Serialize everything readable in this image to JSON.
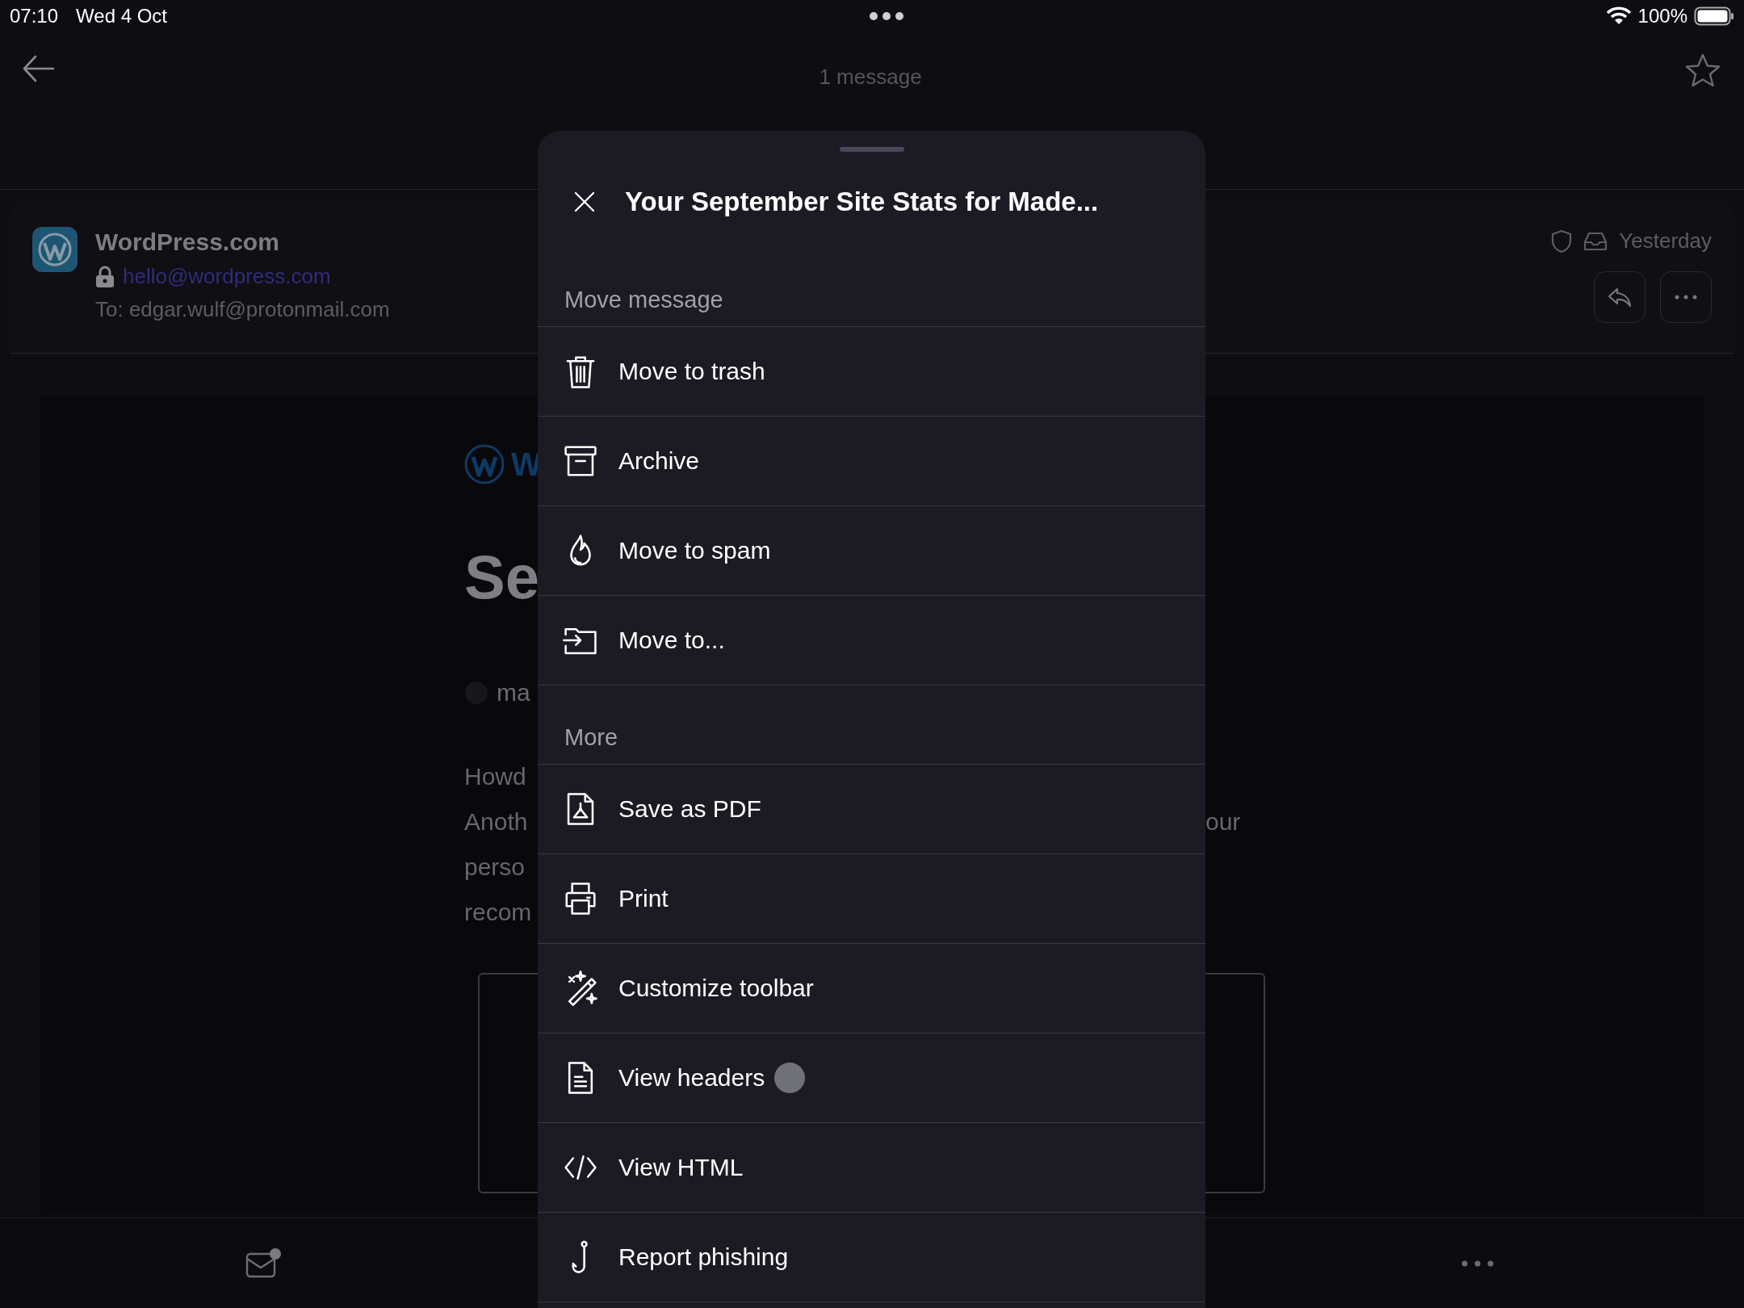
{
  "status_bar": {
    "time": "07:10",
    "date": "Wed 4 Oct",
    "battery": "100%"
  },
  "nav": {
    "title": "1 message",
    "starred": false
  },
  "sender": {
    "name": "WordPress.com",
    "address": "hello@wordpress.com",
    "to_label": "To:",
    "to": "edgar.wulf@protonmail.com",
    "date": "Yesterday"
  },
  "body": {
    "logo_text": "W",
    "heading": "Se",
    "byline": "ma",
    "lines": [
      {
        "left": "Howd"
      },
      {
        "left": "Anoth",
        "right": "our"
      },
      {
        "left": "perso"
      },
      {
        "left": "recom"
      }
    ]
  },
  "sheet": {
    "title": "Your September Site Stats for Made...",
    "sections": [
      {
        "header": "Move message",
        "items": [
          {
            "label": "Move to trash"
          },
          {
            "label": "Archive"
          },
          {
            "label": "Move to spam"
          },
          {
            "label": "Move to..."
          }
        ]
      },
      {
        "header": "More",
        "items": [
          {
            "label": "Save as PDF"
          },
          {
            "label": "Print"
          },
          {
            "label": "Customize toolbar"
          },
          {
            "label": "View headers",
            "indicator": true
          },
          {
            "label": "View HTML"
          },
          {
            "label": "Report phishing"
          }
        ]
      }
    ]
  },
  "bottom_bar": {
    "mail_badge": true
  }
}
